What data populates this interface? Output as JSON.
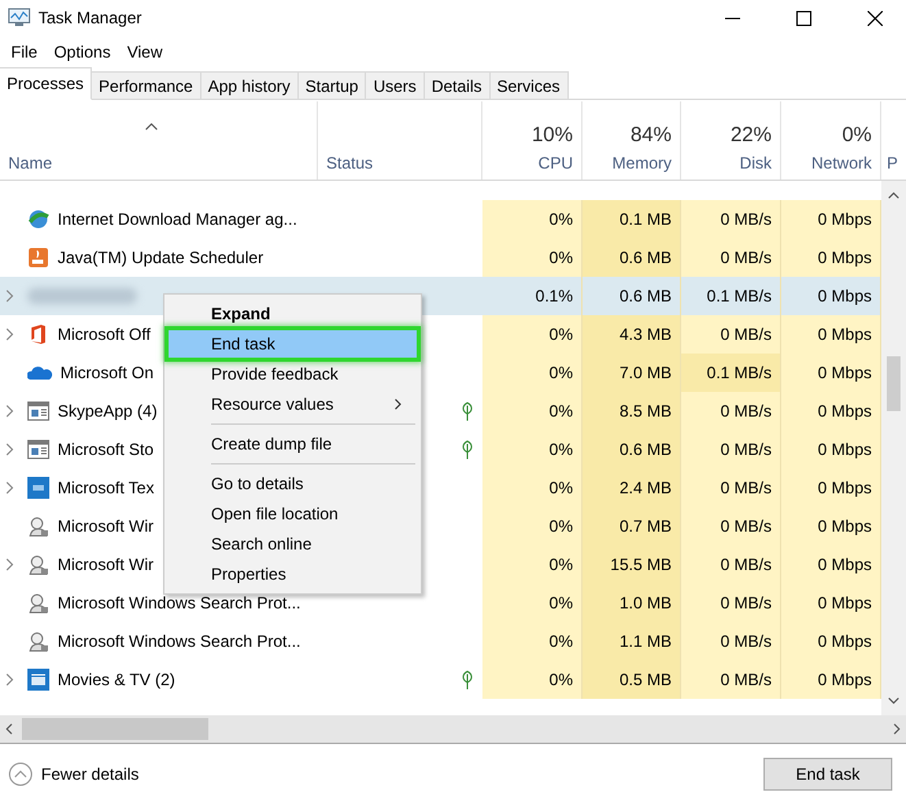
{
  "window": {
    "title": "Task Manager"
  },
  "menu": [
    "File",
    "Options",
    "View"
  ],
  "tabs": [
    {
      "label": "Processes",
      "selected": true
    },
    {
      "label": "Performance",
      "selected": false
    },
    {
      "label": "App history",
      "selected": false
    },
    {
      "label": "Startup",
      "selected": false
    },
    {
      "label": "Users",
      "selected": false
    },
    {
      "label": "Details",
      "selected": false
    },
    {
      "label": "Services",
      "selected": false
    }
  ],
  "columns": [
    {
      "label": "Name"
    },
    {
      "label": "Status"
    },
    {
      "usage": "10%",
      "label": "CPU"
    },
    {
      "usage": "84%",
      "label": "Memory"
    },
    {
      "usage": "22%",
      "label": "Disk"
    },
    {
      "usage": "0%",
      "label": "Network"
    },
    {
      "label": "P"
    }
  ],
  "rows": [
    {
      "name": "Internet Download Manager ag...",
      "kind": "globe",
      "expandable": false,
      "efficiency": false,
      "blurred": false,
      "selected": false,
      "disk_busy": false,
      "cpu": "0%",
      "memory": "0.1 MB",
      "disk": "0 MB/s",
      "network": "0 Mbps"
    },
    {
      "name": "Java(TM) Update Scheduler",
      "kind": "java",
      "expandable": false,
      "efficiency": false,
      "blurred": false,
      "selected": false,
      "disk_busy": false,
      "cpu": "0%",
      "memory": "0.6 MB",
      "disk": "0 MB/s",
      "network": "0 Mbps"
    },
    {
      "kind": "none",
      "expandable": true,
      "efficiency": false,
      "blurred": true,
      "selected": true,
      "disk_busy": false,
      "cpu": "0.1%",
      "memory": "0.6 MB",
      "disk": "0.1 MB/s",
      "network": "0 Mbps"
    },
    {
      "name": "Microsoft Off",
      "kind": "office",
      "expandable": true,
      "efficiency": false,
      "blurred": false,
      "selected": false,
      "disk_busy": false,
      "cpu": "0%",
      "memory": "4.3 MB",
      "disk": "0 MB/s",
      "network": "0 Mbps"
    },
    {
      "name": "Microsoft On",
      "kind": "cloud",
      "expandable": false,
      "efficiency": false,
      "blurred": false,
      "selected": false,
      "disk_busy": true,
      "cpu": "0%",
      "memory": "7.0 MB",
      "disk": "0.1 MB/s",
      "network": "0 Mbps"
    },
    {
      "name": "SkypeApp (4)",
      "kind": "window",
      "expandable": true,
      "efficiency": true,
      "blurred": false,
      "selected": false,
      "disk_busy": false,
      "cpu": "0%",
      "memory": "8.5 MB",
      "disk": "0 MB/s",
      "network": "0 Mbps"
    },
    {
      "name": "Microsoft Sto",
      "kind": "window",
      "expandable": true,
      "efficiency": true,
      "blurred": false,
      "selected": false,
      "disk_busy": false,
      "cpu": "0%",
      "memory": "0.6 MB",
      "disk": "0 MB/s",
      "network": "0 Mbps"
    },
    {
      "name": "Microsoft Tex",
      "kind": "tile",
      "expandable": true,
      "efficiency": false,
      "blurred": false,
      "selected": false,
      "disk_busy": false,
      "cpu": "0%",
      "memory": "2.4 MB",
      "disk": "0 MB/s",
      "network": "0 Mbps"
    },
    {
      "name": "Microsoft Wir",
      "kind": "search",
      "expandable": false,
      "efficiency": false,
      "blurred": false,
      "selected": false,
      "disk_busy": false,
      "cpu": "0%",
      "memory": "0.7 MB",
      "disk": "0 MB/s",
      "network": "0 Mbps"
    },
    {
      "name": "Microsoft Wir",
      "kind": "search",
      "expandable": true,
      "efficiency": false,
      "blurred": false,
      "selected": false,
      "disk_busy": false,
      "cpu": "0%",
      "memory": "15.5 MB",
      "disk": "0 MB/s",
      "network": "0 Mbps"
    },
    {
      "name": "Microsoft Windows Search Prot...",
      "kind": "search",
      "expandable": false,
      "efficiency": false,
      "blurred": false,
      "selected": false,
      "disk_busy": false,
      "cpu": "0%",
      "memory": "1.0 MB",
      "disk": "0 MB/s",
      "network": "0 Mbps"
    },
    {
      "name": "Microsoft Windows Search Prot...",
      "kind": "search",
      "expandable": false,
      "efficiency": false,
      "blurred": false,
      "selected": false,
      "disk_busy": false,
      "cpu": "0%",
      "memory": "1.1 MB",
      "disk": "0 MB/s",
      "network": "0 Mbps"
    },
    {
      "name": "Movies & TV (2)",
      "kind": "movies",
      "expandable": true,
      "efficiency": true,
      "blurred": false,
      "selected": false,
      "disk_busy": false,
      "cpu": "0%",
      "memory": "0.5 MB",
      "disk": "0 MB/s",
      "network": "0 Mbps"
    }
  ],
  "context_menu": [
    {
      "kind": "item",
      "label": "Expand",
      "bold": true,
      "selected": false,
      "submenu": false
    },
    {
      "kind": "item",
      "label": "End task",
      "bold": false,
      "selected": true,
      "submenu": false
    },
    {
      "kind": "item",
      "label": "Provide feedback",
      "bold": false,
      "selected": false,
      "submenu": false
    },
    {
      "kind": "item",
      "label": "Resource values",
      "bold": false,
      "selected": false,
      "submenu": true
    },
    {
      "kind": "separator"
    },
    {
      "kind": "item",
      "label": "Create dump file",
      "bold": false,
      "selected": false,
      "submenu": false
    },
    {
      "kind": "separator"
    },
    {
      "kind": "item",
      "label": "Go to details",
      "bold": false,
      "selected": false,
      "submenu": false
    },
    {
      "kind": "item",
      "label": "Open file location",
      "bold": false,
      "selected": false,
      "submenu": false
    },
    {
      "kind": "item",
      "label": "Search online",
      "bold": false,
      "selected": false,
      "submenu": false
    },
    {
      "kind": "item",
      "label": "Properties",
      "bold": false,
      "selected": false,
      "submenu": false
    }
  ],
  "footer": {
    "details_toggle": "Fewer details",
    "end_task_button": "End task"
  }
}
